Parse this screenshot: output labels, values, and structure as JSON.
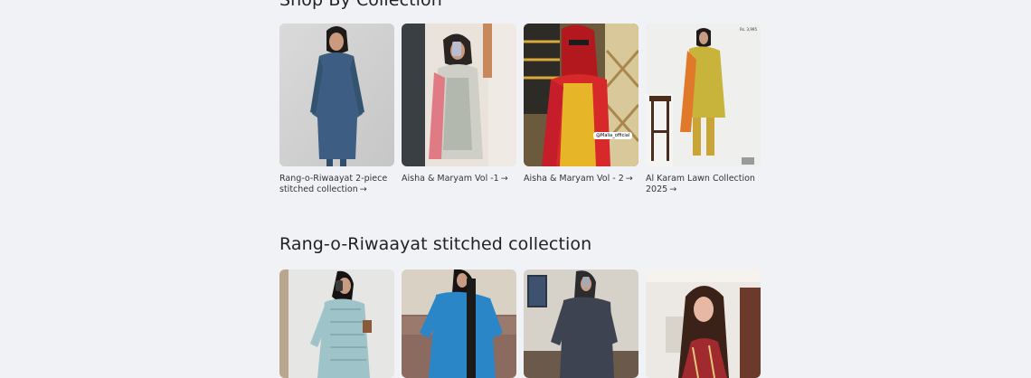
{
  "shop_by_collection": {
    "title": "Shop By Collection",
    "arrow": "→",
    "cards": [
      {
        "caption": "Rang-o-Riwaayat 2-piece stitched collection"
      },
      {
        "caption": "Aisha & Maryam Vol -1"
      },
      {
        "caption": "Aisha & Maryam Vol - 2",
        "watermark": "@Malia_official"
      },
      {
        "caption": "Al Karam Lawn Collection 2025",
        "price": "Rs. 3,995"
      }
    ]
  },
  "stitched_collection": {
    "title": "Rang-o-Riwaayat stitched collection"
  },
  "colors": {
    "background": "#f1f2f6",
    "text": "#2b2b2b"
  }
}
